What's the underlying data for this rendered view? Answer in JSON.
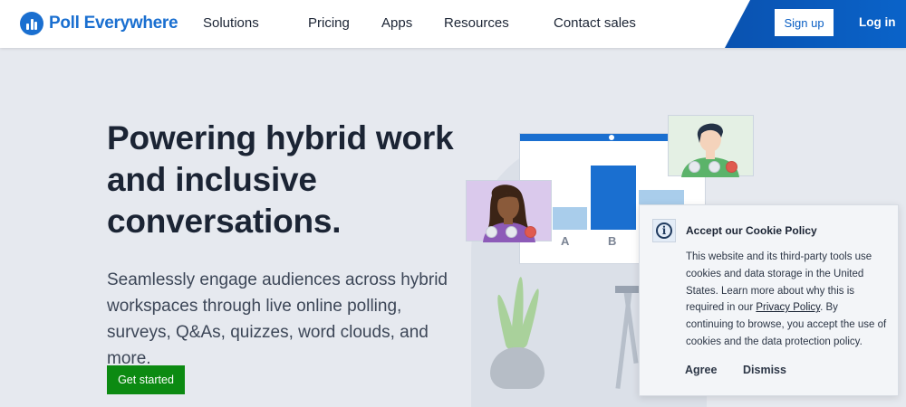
{
  "nav": {
    "brand": "Poll Everywhere",
    "links": [
      "Solutions",
      "Pricing",
      "Apps",
      "Resources",
      "Contact sales"
    ],
    "signup": "Sign up",
    "login": "Log in"
  },
  "hero": {
    "headline": "Powering hybrid work and inclusive conversations.",
    "subtext": "Seamlessly engage audiences across hybrid workspaces through live online polling, surveys, Q&As, quizzes, word clouds, and more.",
    "cta": "Get started"
  },
  "illustration": {
    "bar_labels": [
      "A",
      "B"
    ]
  },
  "cookie": {
    "title": "Accept our Cookie Policy",
    "text_before_link": "This website and its third-party tools use cookies and data storage in the United States. Learn more about why this is required in our ",
    "link": "Privacy Policy",
    "text_after_link": ". By continuing to browse, you accept the use of cookies and the data protection policy.",
    "agree": "Agree",
    "dismiss": "Dismiss"
  },
  "colors": {
    "brand": "#1a6fd0",
    "cta": "#0c8a12",
    "nav_accent": "#0a52b0"
  }
}
